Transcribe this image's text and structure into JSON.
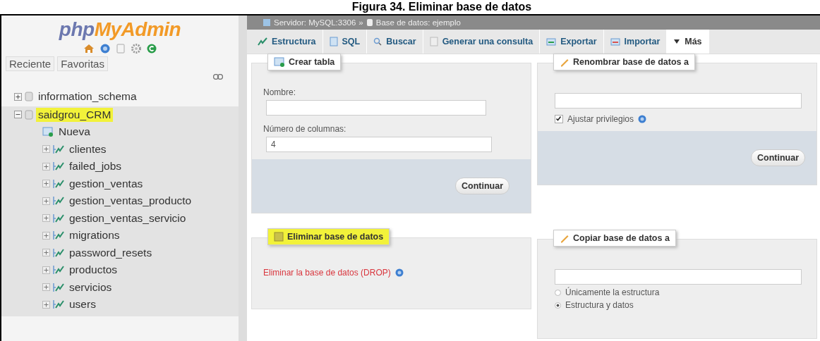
{
  "caption": "Figura 34. Eliminar base de datos",
  "sidebar": {
    "logo": {
      "php": "php",
      "name": "MyAdmin"
    },
    "tabs": [
      {
        "label": "Reciente"
      },
      {
        "label": "Favoritas"
      }
    ],
    "tree": [
      {
        "label": "information_schema",
        "kind": "database",
        "expanded": false,
        "highlighted": false
      },
      {
        "label": "saidgrou_CRM",
        "kind": "database",
        "expanded": true,
        "highlighted": true,
        "children": [
          {
            "label": "Nueva",
            "kind": "new"
          },
          {
            "label": "clientes",
            "kind": "table"
          },
          {
            "label": "failed_jobs",
            "kind": "table"
          },
          {
            "label": "gestion_ventas",
            "kind": "table"
          },
          {
            "label": "gestion_ventas_producto",
            "kind": "table"
          },
          {
            "label": "gestion_ventas_servicio",
            "kind": "table"
          },
          {
            "label": "migrations",
            "kind": "table"
          },
          {
            "label": "password_resets",
            "kind": "table"
          },
          {
            "label": "productos",
            "kind": "table"
          },
          {
            "label": "servicios",
            "kind": "table"
          },
          {
            "label": "users",
            "kind": "table"
          }
        ]
      }
    ]
  },
  "breadcrumb": {
    "server": "Servidor: MySQL:3306",
    "separator": "»",
    "database": "Base de datos: ejemplo"
  },
  "tabs": [
    {
      "label": "Estructura",
      "kind": "structure",
      "selected": false
    },
    {
      "label": "SQL",
      "kind": "sql",
      "selected": false
    },
    {
      "label": "Buscar",
      "kind": "search",
      "selected": false
    },
    {
      "label": "Generar una consulta",
      "kind": "query",
      "selected": false
    },
    {
      "label": "Exportar",
      "kind": "export",
      "selected": false
    },
    {
      "label": "Importar",
      "kind": "import",
      "selected": false
    },
    {
      "label": "Más",
      "kind": "more",
      "selected": true
    }
  ],
  "create_table": {
    "legend": "Crear tabla",
    "name_label": "Nombre:",
    "columns_label": "Número de columnas:",
    "columns_value": "4",
    "button": "Continuar"
  },
  "rename_database": {
    "legend": "Renombrar base de datos a",
    "checkbox": {
      "label": "Ajustar privilegios",
      "checked": true
    },
    "button": "Continuar"
  },
  "drop_database": {
    "legend": "Eliminar base de datos",
    "highlighted": true,
    "link": "Eliminar la base de datos (DROP)"
  },
  "copy_database": {
    "legend": "Copiar base de datos a",
    "options": [
      {
        "label": "Únicamente la estructura",
        "selected": false
      },
      {
        "label": "Estructura y datos",
        "selected": true
      }
    ]
  }
}
